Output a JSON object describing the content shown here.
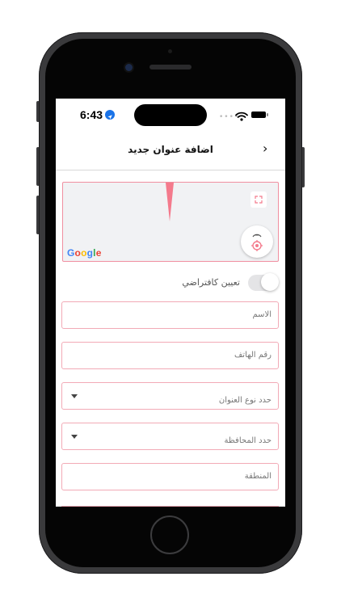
{
  "status_bar": {
    "time": "6:43",
    "location_icon": "location-arrow-icon",
    "signal_icon": "cellular-dots-icon",
    "wifi_icon": "wifi-icon",
    "battery_icon": "battery-icon"
  },
  "header": {
    "title": "اضافة عنوان جديد",
    "back_icon": "chevron-right-icon",
    "back_glyph": "›"
  },
  "map": {
    "attribution": "Google",
    "attribution_colors": [
      "#4285F4",
      "#EA4335",
      "#FBBC05",
      "#4285F4",
      "#34A853",
      "#EA4335"
    ],
    "pin_color": "#f47a8c",
    "border_color": "#f08fa0",
    "expand_icon": "fullscreen-icon",
    "locate_icon": "crosshair-location-icon"
  },
  "default_toggle": {
    "label": "تعيين كافتراضي",
    "checked": false
  },
  "form": {
    "name_placeholder": "الاسم",
    "phone_placeholder": "رقم الهاتف",
    "address_type": {
      "selected": "حدد نوع العنوان",
      "caret_icon": "caret-down-icon"
    },
    "governorate": {
      "selected": "حدد المحافظة",
      "caret_icon": "caret-down-icon"
    },
    "area_placeholder": "المنطقة"
  },
  "colors": {
    "accent": "#f2aab6",
    "locate_accent": "#f47a8c",
    "location_blue": "#1a73e8"
  }
}
